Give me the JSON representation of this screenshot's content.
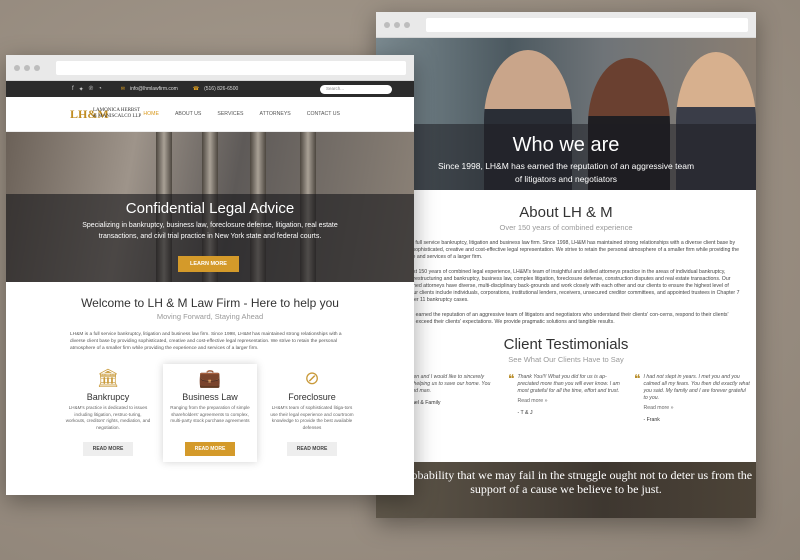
{
  "back": {
    "hero_title": "Who we are",
    "hero_sub": "Since 1998, LH&M has earned the reputation of an aggressive team of litigators and negotiators",
    "about_title": "About LH & M",
    "about_sub": "Over 150 years of combined experience",
    "p1": "LH&M is a full service bankruptcy, litigation and business law firm. Since 1998, LH&M has maintained strong relationships with a diverse client base by providing sophisticated, creative and cost-effective legal representation. We strive to retain the personal atmosphere of a smaller firm while providing the experience and services of a larger firm.",
    "p2": "With almost 150 years of combined legal experience, LH&M's team of insightful and skilled attorneys practice in the areas of individual bankruptcy, corporate restructuring and bankruptcy, business law, complex litigation, foreclosure defense, construction disputes and real estate transactions. Our accomplished attorneys have diverse, multi-disciplinary back-grounds and work closely with each other and our clients to ensure the highest level of service. Our clients include individuals, corporations, institutional lenders, receivers, unsecured creditor committees, and appointed trustees in Chapter 7 and Chapter 11 bankruptcy cases.",
    "p3": "LH&M has earned the reputation of an aggressive team of litigators and negotiators who understand their clients' con-cerns, respond to their clients' needs and exceed their clients' expectations. We provide pragmatic solutions and tangible results.",
    "test_title": "Client Testimonials",
    "test_sub": "See What Our Clients Have to Say",
    "testimonials": [
      {
        "text": "So!, My children and I would like to sincerely thank you for helping us to save our home. You truly are a good man.",
        "read": "",
        "sig": "Loretta, Michael & Family"
      },
      {
        "text": "Thank You!!! What you did for us is ap-preciated more than you will ever know. I am most grateful for all the time, effort and trust.",
        "read": "Read more »",
        "sig": "- T & J"
      },
      {
        "text": "I had not slept in years. I met you and you calmed all my fears. You then did exactly what you said. My family and I are forever grateful to you.",
        "read": "Read more »",
        "sig": "- Frank"
      }
    ],
    "quote": "The probability that we may fail in the struggle ought not to deter us from the support of a cause we believe to be just."
  },
  "front": {
    "topbar": {
      "email": "info@lhmlawfirm.com",
      "phone": "(516) 826-6500",
      "search_placeholder": "Search..."
    },
    "social_icons": [
      "facebook-icon",
      "twitter-icon",
      "pinterest-icon",
      "rss-icon"
    ],
    "logo_mark": "LH&M",
    "logo_text": "LAMONICA HERBST & MANISCALCO LLP",
    "nav": [
      "HOME",
      "ABOUT US",
      "SERVICES",
      "ATTORNEYS",
      "CONTACT US"
    ],
    "banner_title": "Confidential Legal Advice",
    "banner_sub": "Specializing in bankruptcy, business law, foreclosure defense, litigation, real estate transactions, and civil trial practice in New York state and federal courts.",
    "learn_more": "LEARN MORE",
    "welcome_title": "Welcome to LH & M Law Firm - Here to help you",
    "welcome_sub": "Moving Forward, Staying Ahead",
    "welcome_para": "LH&M is a full service bankruptcy, litigation and business law firm. Since 1998, LH&M has maintained strong relationships with a diverse client base by providing sophisticated, creative and cost-effective legal representation. We strive to retain the personal atmosphere of a smaller firm while providing the experience and services of a larger firm.",
    "cards": [
      {
        "title": "Bankrupcy",
        "text": "LH&M's practice is dedicated to issues including litigation, restruc-turing, workouts, creditors' rights, mediation, and negotiation.",
        "btn": "READ MORE"
      },
      {
        "title": "Business Law",
        "text": "Ranging from the preparation of simple shareholders' agreements to complex, multi-party stock purchase agreements",
        "btn": "READ MORE"
      },
      {
        "title": "Foreclosure",
        "text": "LH&M's team of sophisticated litiga-tors use their legal experience and courtroom knowledge to provide the best available defenses",
        "btn": "READ MORE"
      }
    ]
  }
}
